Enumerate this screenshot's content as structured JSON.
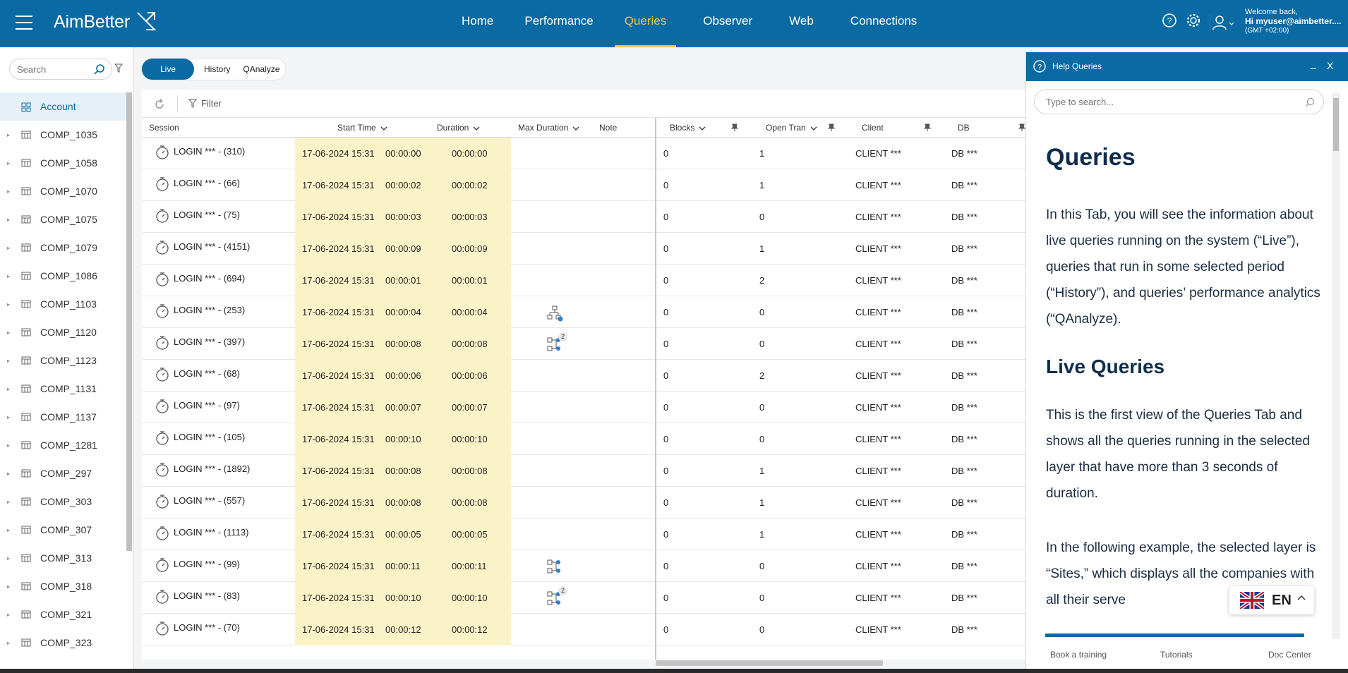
{
  "app": {
    "logo_text": "AimBetter"
  },
  "nav": [
    {
      "label": "Home",
      "active": false
    },
    {
      "label": "Performance",
      "active": false
    },
    {
      "label": "Queries",
      "active": true
    },
    {
      "label": "Observer",
      "active": false
    },
    {
      "label": "Web",
      "active": false
    },
    {
      "label": "Connections",
      "active": false
    }
  ],
  "user": {
    "welcome": "Welcome back,",
    "name": "Hi myuser@aimbetter....",
    "tz": "(GMT +02:00)"
  },
  "sidebar": {
    "search_placeholder": "Search",
    "items": [
      "Account",
      "COMP_1035",
      "COMP_1058",
      "COMP_1070",
      "COMP_1075",
      "COMP_1079",
      "COMP_1086",
      "COMP_1103",
      "COMP_1120",
      "COMP_1123",
      "COMP_1131",
      "COMP_1137",
      "COMP_1281",
      "COMP_297",
      "COMP_303",
      "COMP_307",
      "COMP_313",
      "COMP_318",
      "COMP_321",
      "COMP_323"
    ]
  },
  "tabs": [
    {
      "label": "Live",
      "active": true
    },
    {
      "label": "History",
      "active": false
    },
    {
      "label": "QAnalyze",
      "active": false
    }
  ],
  "toolbar": {
    "filter_label": "Filter"
  },
  "grid": {
    "headers": [
      "Session",
      "Start Time",
      "Duration",
      "Max Duration",
      "Note",
      "Blocks",
      "Open Tran",
      "Client",
      "DB"
    ],
    "rows": [
      {
        "session": "LOGIN *** - (310)",
        "start": "17-06-2024 15:31",
        "duration": "00:00:00",
        "max": "00:00:00",
        "note": "",
        "blocks": "0",
        "open": "1",
        "client": "CLIENT ***",
        "db": "DB ***"
      },
      {
        "session": "LOGIN *** - (66)",
        "start": "17-06-2024 15:31",
        "duration": "00:00:02",
        "max": "00:00:02",
        "note": "",
        "blocks": "0",
        "open": "1",
        "client": "CLIENT ***",
        "db": "DB ***"
      },
      {
        "session": "LOGIN *** - (75)",
        "start": "17-06-2024 15:31",
        "duration": "00:00:03",
        "max": "00:00:03",
        "note": "",
        "blocks": "0",
        "open": "0",
        "client": "CLIENT ***",
        "db": "DB ***"
      },
      {
        "session": "LOGIN *** - (4151)",
        "start": "17-06-2024 15:31",
        "duration": "00:00:09",
        "max": "00:00:09",
        "note": "",
        "blocks": "0",
        "open": "1",
        "client": "CLIENT ***",
        "db": "DB ***"
      },
      {
        "session": "LOGIN *** - (694)",
        "start": "17-06-2024 15:31",
        "duration": "00:00:01",
        "max": "00:00:01",
        "note": "",
        "blocks": "0",
        "open": "2",
        "client": "CLIENT ***",
        "db": "DB ***"
      },
      {
        "session": "LOGIN *** - (253)",
        "start": "17-06-2024 15:31",
        "duration": "00:00:04",
        "max": "00:00:04",
        "note": "tree",
        "blocks": "0",
        "open": "0",
        "client": "CLIENT ***",
        "db": "DB ***"
      },
      {
        "session": "LOGIN *** - (397)",
        "start": "17-06-2024 15:31",
        "duration": "00:00:08",
        "max": "00:00:08",
        "note": "plan2",
        "blocks": "0",
        "open": "0",
        "client": "CLIENT ***",
        "db": "DB ***"
      },
      {
        "session": "LOGIN *** - (68)",
        "start": "17-06-2024 15:31",
        "duration": "00:00:06",
        "max": "00:00:06",
        "note": "",
        "blocks": "0",
        "open": "2",
        "client": "CLIENT ***",
        "db": "DB ***"
      },
      {
        "session": "LOGIN *** - (97)",
        "start": "17-06-2024 15:31",
        "duration": "00:00:07",
        "max": "00:00:07",
        "note": "",
        "blocks": "0",
        "open": "0",
        "client": "CLIENT ***",
        "db": "DB ***"
      },
      {
        "session": "LOGIN *** - (105)",
        "start": "17-06-2024 15:31",
        "duration": "00:00:10",
        "max": "00:00:10",
        "note": "",
        "blocks": "0",
        "open": "0",
        "client": "CLIENT ***",
        "db": "DB ***"
      },
      {
        "session": "LOGIN *** - (1892)",
        "start": "17-06-2024 15:31",
        "duration": "00:00:08",
        "max": "00:00:08",
        "note": "",
        "blocks": "0",
        "open": "1",
        "client": "CLIENT ***",
        "db": "DB ***"
      },
      {
        "session": "LOGIN *** - (557)",
        "start": "17-06-2024 15:31",
        "duration": "00:00:08",
        "max": "00:00:08",
        "note": "",
        "blocks": "0",
        "open": "1",
        "client": "CLIENT ***",
        "db": "DB ***"
      },
      {
        "session": "LOGIN *** - (1113)",
        "start": "17-06-2024 15:31",
        "duration": "00:00:05",
        "max": "00:00:05",
        "note": "",
        "blocks": "0",
        "open": "1",
        "client": "CLIENT ***",
        "db": "DB ***"
      },
      {
        "session": "LOGIN *** - (99)",
        "start": "17-06-2024 15:31",
        "duration": "00:00:11",
        "max": "00:00:11",
        "note": "plan",
        "blocks": "0",
        "open": "0",
        "client": "CLIENT ***",
        "db": "DB ***"
      },
      {
        "session": "LOGIN *** - (83)",
        "start": "17-06-2024 15:31",
        "duration": "00:00:10",
        "max": "00:00:10",
        "note": "plan2",
        "blocks": "0",
        "open": "0",
        "client": "CLIENT ***",
        "db": "DB ***"
      },
      {
        "session": "LOGIN *** - (70)",
        "start": "17-06-2024 15:31",
        "duration": "00:00:12",
        "max": "00:00:12",
        "note": "",
        "blocks": "0",
        "open": "0",
        "client": "CLIENT ***",
        "db": "DB ***"
      }
    ],
    "note_badge": "2"
  },
  "help": {
    "title": "Help Queries",
    "minimize": "_",
    "close": "X",
    "search_placeholder": "Type to search...",
    "h1": "Queries",
    "p1": "In this Tab, you will see the information about live queries running on the system (“Live”), queries that run in some selected period (“History”), and queries’ performance analytics (“QAnalyze).",
    "h2": "Live Queries",
    "p2": "This is the first view of the Queries Tab and shows all the queries running in the selected layer that have more than 3 seconds of duration.",
    "p3": "In the following example, the selected layer is “Sites,” which displays all the companies with all their serve",
    "footer": [
      "Book a training",
      "Tutorials",
      "Doc Center"
    ],
    "lang": "EN"
  },
  "colors": {
    "brand": "#0a6aa3",
    "active_nav": "#f5c542",
    "highlight_col": "#fbf3c8"
  }
}
